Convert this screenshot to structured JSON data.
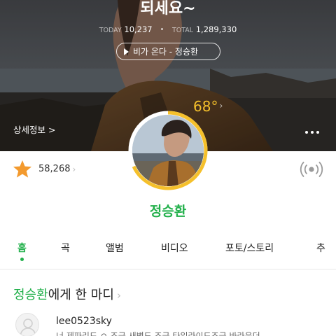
{
  "hero": {
    "title": "되세요~",
    "today_label": "TODAY",
    "today_count": "10,237",
    "total_label": "TOTAL",
    "total_count": "1,289,330",
    "now_playing": "비가 온다 - 정승환",
    "detail_link": "상세정보 >",
    "temperature": "68°",
    "temperature_fill": 0.68
  },
  "colors": {
    "accent": "#22b04b",
    "temperature": "#f5c02b",
    "star": "#f39a2e"
  },
  "profile": {
    "likes": "58,268",
    "artist_name": "정승환"
  },
  "tabs": [
    {
      "label": "홈",
      "active": true
    },
    {
      "label": "곡"
    },
    {
      "label": "앨범"
    },
    {
      "label": "비디오"
    },
    {
      "label": "포토/스토리"
    },
    {
      "label": "추"
    }
  ],
  "comments": {
    "heading_artist": "정승환",
    "heading_rest": "에게 한 마디",
    "items": [
      {
        "user": "lee0523sky",
        "text": "너 제파리드 ㅇ 조금 새벽도 조금 타입라이드조금 바라운더"
      }
    ]
  },
  "icons": {
    "play": "play-icon",
    "more": "more-dots-icon",
    "star": "star-icon",
    "live": "live-broadcast-icon",
    "avatar_placeholder": "user-placeholder-icon"
  }
}
